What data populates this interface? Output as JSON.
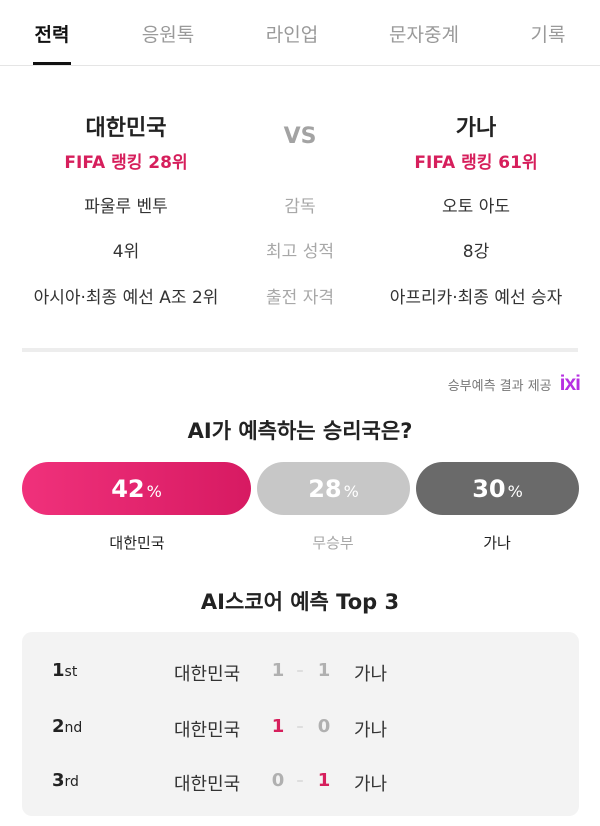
{
  "tabs": [
    {
      "label": "전력",
      "active": true
    },
    {
      "label": "응원톡",
      "active": false
    },
    {
      "label": "라인업",
      "active": false
    },
    {
      "label": "문자중계",
      "active": false
    },
    {
      "label": "기록",
      "active": false
    }
  ],
  "match": {
    "home": {
      "name": "대한민국",
      "fifa_rank": "FIFA 랭킹 28위",
      "coach": "파울루 벤투",
      "best": "4위",
      "qualification": "아시아·최종 예선 A조 2위"
    },
    "away": {
      "name": "가나",
      "fifa_rank": "FIFA 랭킹 61위",
      "coach": "오토 아도",
      "best": "8강",
      "qualification": "아프리카·최종 예선 승자"
    },
    "vs_label": "VS",
    "labels": {
      "coach": "감독",
      "best": "최고 성적",
      "qualification": "출전 자격"
    }
  },
  "provider": {
    "text": "승부예측 결과 제공",
    "logo_text": "ixi",
    "logo_color": "#b72fe2"
  },
  "prediction": {
    "title": "AI가 예측하는 승리국은?",
    "unit": "%",
    "options": [
      {
        "label": "대한민국",
        "value": 42,
        "value_text": "42",
        "color": "#e3256c"
      },
      {
        "label": "무승부",
        "value": 28,
        "value_text": "28",
        "color": "#c7c7c7"
      },
      {
        "label": "가나",
        "value": 30,
        "value_text": "30",
        "color": "#6a6a6a"
      }
    ]
  },
  "scores": {
    "title": "AI스코어 예측 Top 3",
    "dash": "–",
    "rows": [
      {
        "rank_num": "1",
        "rank_suffix": "st",
        "home": "대한민국",
        "home_score": "1",
        "away_score": "1",
        "away": "가나"
      },
      {
        "rank_num": "2",
        "rank_suffix": "nd",
        "home": "대한민국",
        "home_score": "1",
        "away_score": "0",
        "away": "가나"
      },
      {
        "rank_num": "3",
        "rank_suffix": "rd",
        "home": "대한민국",
        "home_score": "0",
        "away_score": "1",
        "away": "가나"
      }
    ]
  },
  "colors": {
    "accent": "#d61f5c",
    "muted": "#a8a8a8"
  }
}
